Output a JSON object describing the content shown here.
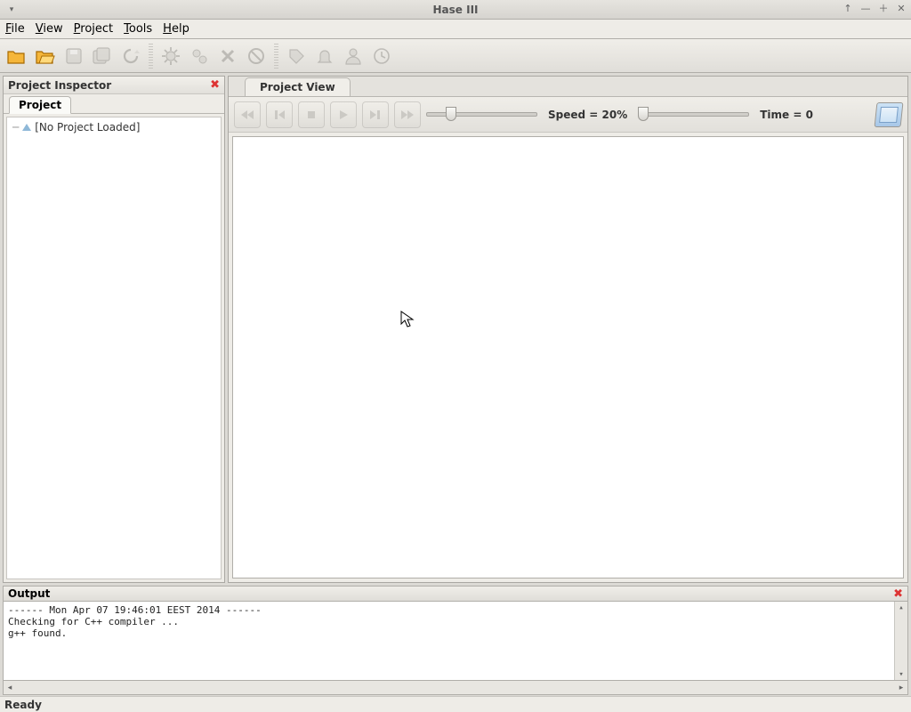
{
  "window": {
    "title": "Hase III"
  },
  "menu": {
    "file": "File",
    "view": "View",
    "project": "Project",
    "tools": "Tools",
    "help": "Help"
  },
  "inspector": {
    "title": "Project Inspector",
    "tab": "Project",
    "root": "[No Project Loaded]"
  },
  "projectview": {
    "tab": "Project View",
    "speed_label": "Speed = 20%",
    "speed_value": 20,
    "time_label": "Time = 0",
    "time_value": 0
  },
  "output": {
    "title": "Output",
    "lines": "------ Mon Apr 07 19:46:01 EEST 2014 ------\nChecking for C++ compiler ...\ng++ found."
  },
  "status": {
    "text": "Ready"
  }
}
